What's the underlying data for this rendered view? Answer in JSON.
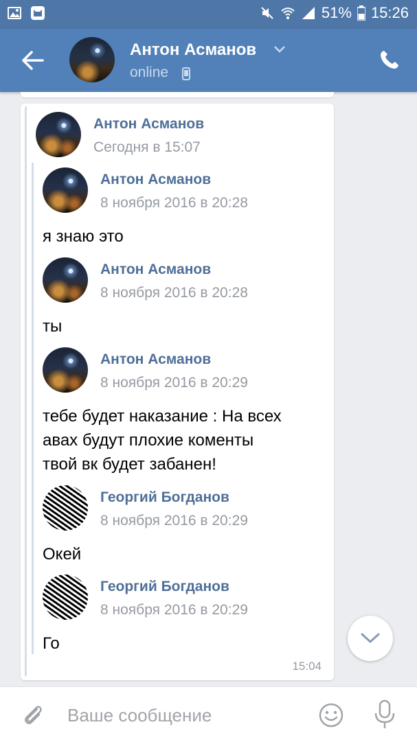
{
  "status_bar": {
    "battery": "51%",
    "time": "15:26",
    "icons": [
      "image-icon",
      "cat-app-icon",
      "mute-icon",
      "wifi-icon",
      "signal-icon",
      "battery-icon"
    ]
  },
  "header": {
    "name": "Антон Асманов",
    "status": "online",
    "icons": [
      "back-arrow-icon",
      "chevron-down-icon",
      "mobile-phone-icon",
      "phone-call-icon"
    ],
    "accent_color": "#5181b8"
  },
  "outer_message": {
    "sender": "Антон Асманов",
    "date": "Сегодня в 15:07",
    "time": "15:04"
  },
  "forwarded": [
    {
      "sender": "Антон Асманов",
      "date": "8 ноября 2016 в 20:28",
      "text": "я знаю это"
    },
    {
      "sender": "Антон Асманов",
      "date": "8 ноября 2016 в 20:28",
      "text": "ты"
    },
    {
      "sender": "Антон Асманов",
      "date": "8 ноября 2016 в 20:29",
      "text_lines": [
        "тебе будет наказание : На всех",
        "авах будут плохие коменты",
        "твой вк будет забанен!"
      ]
    },
    {
      "sender": "Георгий Богданов",
      "date": "8 ноября 2016 в 20:29",
      "text": "Окей"
    },
    {
      "sender": "Георгий Богданов",
      "date": "8 ноября 2016 в 20:29",
      "text": "Го"
    }
  ],
  "input": {
    "placeholder": "Ваше сообщение",
    "icons": [
      "paperclip-icon",
      "emoji-icon",
      "microphone-icon"
    ]
  }
}
